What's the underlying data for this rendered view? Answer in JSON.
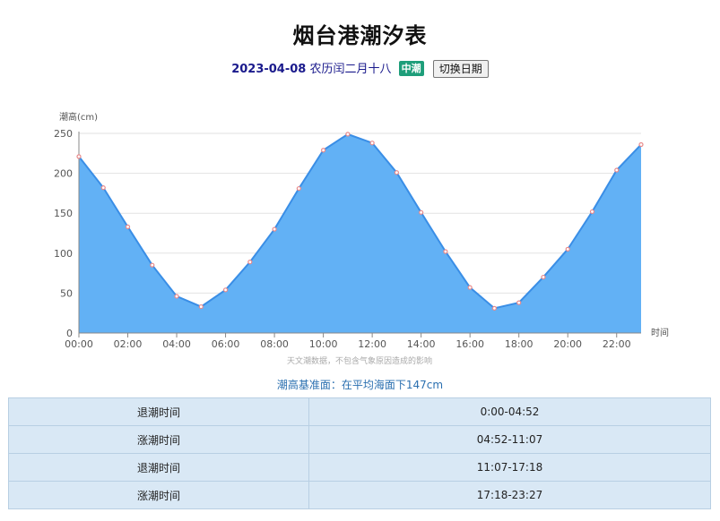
{
  "header": {
    "title": "烟台港潮汐表",
    "date": "2023-04-08",
    "lunar": "农历闰二月十八",
    "tide_badge": "中潮",
    "switch_label": "切换日期"
  },
  "chart_data": {
    "type": "area",
    "ylabel": "潮高(cm)",
    "xlabel": "时间",
    "x_hours": [
      0,
      1,
      2,
      3,
      4,
      5,
      6,
      7,
      8,
      9,
      10,
      11,
      12,
      13,
      14,
      15,
      16,
      17,
      18,
      19,
      20,
      21,
      22,
      23
    ],
    "values": [
      221,
      182,
      133,
      85,
      46,
      33,
      54,
      89,
      130,
      181,
      229,
      249,
      238,
      201,
      151,
      102,
      57,
      31,
      38,
      70,
      105,
      152,
      204,
      236
    ],
    "xlim": [
      0,
      23
    ],
    "ylim": [
      0,
      250
    ],
    "yticks": [
      0,
      50,
      100,
      150,
      200,
      250
    ],
    "xtick_labels": [
      "00:00",
      "02:00",
      "04:00",
      "06:00",
      "08:00",
      "10:00",
      "12:00",
      "14:00",
      "16:00",
      "18:00",
      "20:00",
      "22:00"
    ],
    "grid": true,
    "colors": {
      "fill": "#62b1f5",
      "line": "#3a8ee6",
      "point": "#e8898a"
    },
    "note": "天文潮数据，不包含气象原因造成的影响"
  },
  "datum_text": "潮高基准面：在平均海面下147cm",
  "tide_table": [
    {
      "label": "退潮时间",
      "value": "0:00-04:52"
    },
    {
      "label": "涨潮时间",
      "value": "04:52-11:07"
    },
    {
      "label": "退潮时间",
      "value": "11:07-17:18"
    },
    {
      "label": "涨潮时间",
      "value": "17:18-23:27"
    }
  ]
}
